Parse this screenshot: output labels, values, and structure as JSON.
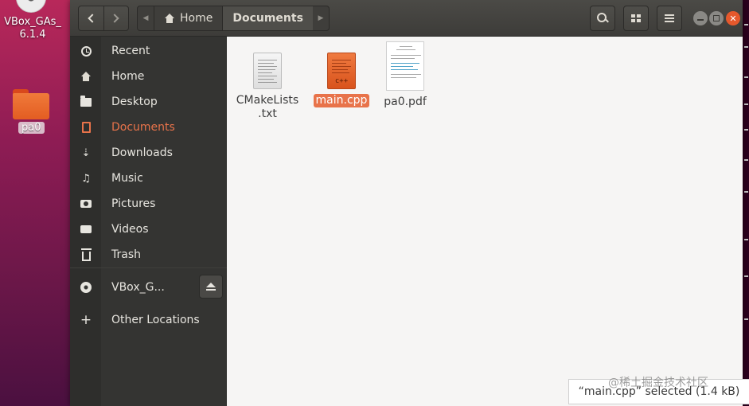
{
  "desktop": {
    "vbox_label": "VBox_GAs_ 6.1.4",
    "folder_label": "pa0"
  },
  "headerbar": {
    "path": [
      {
        "label": "Home",
        "icon": "home-icon"
      },
      {
        "label": "Documents",
        "active": true
      }
    ],
    "accent": "#e8734a"
  },
  "sidebar": {
    "items": [
      {
        "label": "Recent",
        "icon": "clock-icon"
      },
      {
        "label": "Home",
        "icon": "home-icon"
      },
      {
        "label": "Desktop",
        "icon": "desktop-folder-icon"
      },
      {
        "label": "Documents",
        "icon": "document-icon",
        "selected": true
      },
      {
        "label": "Downloads",
        "icon": "download-icon"
      },
      {
        "label": "Music",
        "icon": "music-icon"
      },
      {
        "label": "Pictures",
        "icon": "camera-icon"
      },
      {
        "label": "Videos",
        "icon": "video-icon"
      },
      {
        "label": "Trash",
        "icon": "trash-icon"
      },
      {
        "label": "VBox_G...",
        "icon": "disc-icon"
      },
      {
        "label": "Other Locations",
        "icon": "plus-icon"
      }
    ]
  },
  "files": [
    {
      "name": "CMakeLists .txt",
      "type": "text"
    },
    {
      "name": "main.cpp",
      "type": "cpp",
      "icon_text": "c++",
      "selected": true
    },
    {
      "name": "pa0.pdf",
      "type": "pdf"
    }
  ],
  "status": {
    "text": "“main.cpp” selected  (1.4 kB)"
  },
  "watermark": "@稀土掘金技术社区"
}
